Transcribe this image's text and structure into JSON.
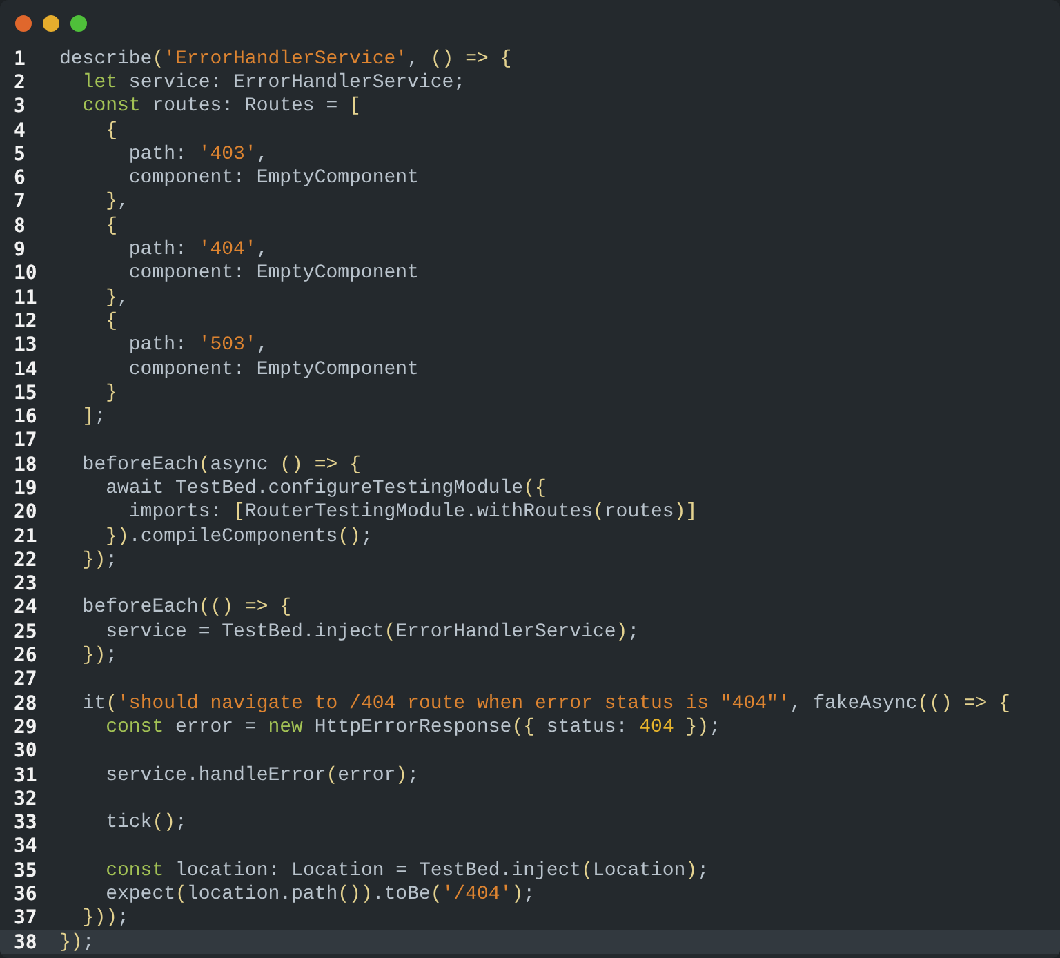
{
  "window": {
    "controls": [
      {
        "color": "#e0672c"
      },
      {
        "color": "#e6ad2d"
      },
      {
        "color": "#4fbf3a"
      }
    ]
  },
  "lines": [
    {
      "number": "1",
      "current": false,
      "tokens": [
        {
          "kind": "plain",
          "text": "describe"
        },
        {
          "kind": "bracket",
          "text": "("
        },
        {
          "kind": "string",
          "text": "'ErrorHandlerService'"
        },
        {
          "kind": "plain",
          "text": ", "
        },
        {
          "kind": "bracket",
          "text": "()"
        },
        {
          "kind": "bracket",
          "text": " =>"
        },
        {
          "kind": "bracket",
          "text": " {"
        }
      ]
    },
    {
      "number": "2",
      "current": false,
      "tokens": [
        {
          "kind": "keyword",
          "text": "  let"
        },
        {
          "kind": "plain",
          "text": " service: ErrorHandlerService;"
        }
      ]
    },
    {
      "number": "3",
      "current": false,
      "tokens": [
        {
          "kind": "keyword",
          "text": "  const"
        },
        {
          "kind": "plain",
          "text": " routes: Routes = "
        },
        {
          "kind": "bracket",
          "text": "["
        }
      ]
    },
    {
      "number": "4",
      "current": false,
      "tokens": [
        {
          "kind": "bracket",
          "text": "    {"
        }
      ]
    },
    {
      "number": "5",
      "current": false,
      "tokens": [
        {
          "kind": "plain",
          "text": "      path: "
        },
        {
          "kind": "string",
          "text": "'403'"
        },
        {
          "kind": "plain",
          "text": ","
        }
      ]
    },
    {
      "number": "6",
      "current": false,
      "tokens": [
        {
          "kind": "plain",
          "text": "      component: EmptyComponent"
        }
      ]
    },
    {
      "number": "7",
      "current": false,
      "tokens": [
        {
          "kind": "bracket",
          "text": "    }"
        },
        {
          "kind": "plain",
          "text": ","
        }
      ]
    },
    {
      "number": "8",
      "current": false,
      "tokens": [
        {
          "kind": "bracket",
          "text": "    {"
        }
      ]
    },
    {
      "number": "9",
      "current": false,
      "tokens": [
        {
          "kind": "plain",
          "text": "      path: "
        },
        {
          "kind": "string",
          "text": "'404'"
        },
        {
          "kind": "plain",
          "text": ","
        }
      ]
    },
    {
      "number": "10",
      "current": false,
      "tokens": [
        {
          "kind": "plain",
          "text": "      component: EmptyComponent"
        }
      ]
    },
    {
      "number": "11",
      "current": false,
      "tokens": [
        {
          "kind": "bracket",
          "text": "    }"
        },
        {
          "kind": "plain",
          "text": ","
        }
      ]
    },
    {
      "number": "12",
      "current": false,
      "tokens": [
        {
          "kind": "bracket",
          "text": "    {"
        }
      ]
    },
    {
      "number": "13",
      "current": false,
      "tokens": [
        {
          "kind": "plain",
          "text": "      path: "
        },
        {
          "kind": "string",
          "text": "'503'"
        },
        {
          "kind": "plain",
          "text": ","
        }
      ]
    },
    {
      "number": "14",
      "current": false,
      "tokens": [
        {
          "kind": "plain",
          "text": "      component: EmptyComponent"
        }
      ]
    },
    {
      "number": "15",
      "current": false,
      "tokens": [
        {
          "kind": "bracket",
          "text": "    }"
        }
      ]
    },
    {
      "number": "16",
      "current": false,
      "tokens": [
        {
          "kind": "bracket",
          "text": "  ]"
        },
        {
          "kind": "plain",
          "text": ";"
        }
      ]
    },
    {
      "number": "17",
      "current": false
    },
    {
      "number": "18",
      "current": false,
      "tokens": [
        {
          "kind": "plain",
          "text": "  beforeEach"
        },
        {
          "kind": "bracket",
          "text": "("
        },
        {
          "kind": "plain",
          "text": "async "
        },
        {
          "kind": "bracket",
          "text": "()"
        },
        {
          "kind": "bracket",
          "text": " =>"
        },
        {
          "kind": "bracket",
          "text": " {"
        }
      ]
    },
    {
      "number": "19",
      "current": false,
      "tokens": [
        {
          "kind": "plain",
          "text": "    await TestBed.configureTestingModule"
        },
        {
          "kind": "bracket",
          "text": "({"
        }
      ]
    },
    {
      "number": "20",
      "current": false,
      "tokens": [
        {
          "kind": "plain",
          "text": "      imports: "
        },
        {
          "kind": "bracket",
          "text": "["
        },
        {
          "kind": "plain",
          "text": "RouterTestingModule.withRoutes"
        },
        {
          "kind": "bracket",
          "text": "("
        },
        {
          "kind": "plain",
          "text": "routes"
        },
        {
          "kind": "bracket",
          "text": ")]"
        }
      ]
    },
    {
      "number": "21",
      "current": false,
      "tokens": [
        {
          "kind": "bracket",
          "text": "    })"
        },
        {
          "kind": "plain",
          "text": ".compileComponents"
        },
        {
          "kind": "bracket",
          "text": "()"
        },
        {
          "kind": "plain",
          "text": ";"
        }
      ]
    },
    {
      "number": "22",
      "current": false,
      "tokens": [
        {
          "kind": "bracket",
          "text": "  })"
        },
        {
          "kind": "plain",
          "text": ";"
        }
      ]
    },
    {
      "number": "23",
      "current": false
    },
    {
      "number": "24",
      "current": false,
      "tokens": [
        {
          "kind": "plain",
          "text": "  beforeEach"
        },
        {
          "kind": "bracket",
          "text": "(()"
        },
        {
          "kind": "bracket",
          "text": " =>"
        },
        {
          "kind": "bracket",
          "text": " {"
        }
      ]
    },
    {
      "number": "25",
      "current": false,
      "tokens": [
        {
          "kind": "plain",
          "text": "    service = TestBed.inject"
        },
        {
          "kind": "bracket",
          "text": "("
        },
        {
          "kind": "plain",
          "text": "ErrorHandlerService"
        },
        {
          "kind": "bracket",
          "text": ")"
        },
        {
          "kind": "plain",
          "text": ";"
        }
      ]
    },
    {
      "number": "26",
      "current": false,
      "tokens": [
        {
          "kind": "bracket",
          "text": "  })"
        },
        {
          "kind": "plain",
          "text": ";"
        }
      ]
    },
    {
      "number": "27",
      "current": false
    },
    {
      "number": "28",
      "current": false,
      "tokens": [
        {
          "kind": "plain",
          "text": "  it"
        },
        {
          "kind": "bracket",
          "text": "("
        },
        {
          "kind": "string",
          "text": "'should navigate to /404 route when error status is \"404\"'"
        },
        {
          "kind": "plain",
          "text": ", fakeAsync"
        },
        {
          "kind": "bracket",
          "text": "(()"
        },
        {
          "kind": "bracket",
          "text": " =>"
        },
        {
          "kind": "bracket",
          "text": " {"
        }
      ]
    },
    {
      "number": "29",
      "current": false,
      "tokens": [
        {
          "kind": "keyword",
          "text": "    const"
        },
        {
          "kind": "plain",
          "text": " error = "
        },
        {
          "kind": "keyword",
          "text": "new"
        },
        {
          "kind": "plain",
          "text": " HttpErrorResponse"
        },
        {
          "kind": "bracket",
          "text": "({"
        },
        {
          "kind": "plain",
          "text": " status: "
        },
        {
          "kind": "number",
          "text": "404"
        },
        {
          "kind": "bracket",
          "text": " })"
        },
        {
          "kind": "plain",
          "text": ";"
        }
      ]
    },
    {
      "number": "30",
      "current": false
    },
    {
      "number": "31",
      "current": false,
      "tokens": [
        {
          "kind": "plain",
          "text": "    service.handleError"
        },
        {
          "kind": "bracket",
          "text": "("
        },
        {
          "kind": "plain",
          "text": "error"
        },
        {
          "kind": "bracket",
          "text": ")"
        },
        {
          "kind": "plain",
          "text": ";"
        }
      ]
    },
    {
      "number": "32",
      "current": false
    },
    {
      "number": "33",
      "current": false,
      "tokens": [
        {
          "kind": "plain",
          "text": "    tick"
        },
        {
          "kind": "bracket",
          "text": "()"
        },
        {
          "kind": "plain",
          "text": ";"
        }
      ]
    },
    {
      "number": "34",
      "current": false
    },
    {
      "number": "35",
      "current": false,
      "tokens": [
        {
          "kind": "keyword",
          "text": "    const"
        },
        {
          "kind": "plain",
          "text": " location: Location = TestBed.inject"
        },
        {
          "kind": "bracket",
          "text": "("
        },
        {
          "kind": "plain",
          "text": "Location"
        },
        {
          "kind": "bracket",
          "text": ")"
        },
        {
          "kind": "plain",
          "text": ";"
        }
      ]
    },
    {
      "number": "36",
      "current": false,
      "tokens": [
        {
          "kind": "plain",
          "text": "    expect"
        },
        {
          "kind": "bracket",
          "text": "("
        },
        {
          "kind": "plain",
          "text": "location.path"
        },
        {
          "kind": "bracket",
          "text": "())"
        },
        {
          "kind": "plain",
          "text": ".toBe"
        },
        {
          "kind": "bracket",
          "text": "("
        },
        {
          "kind": "string",
          "text": "'/404'"
        },
        {
          "kind": "bracket",
          "text": ")"
        },
        {
          "kind": "plain",
          "text": ";"
        }
      ]
    },
    {
      "number": "37",
      "current": false,
      "tokens": [
        {
          "kind": "bracket",
          "text": "  }))"
        },
        {
          "kind": "plain",
          "text": ";"
        }
      ]
    },
    {
      "number": "38",
      "current": true,
      "tokens": [
        {
          "kind": "bracket",
          "text": "})"
        },
        {
          "kind": "plain",
          "text": ";"
        }
      ]
    }
  ]
}
